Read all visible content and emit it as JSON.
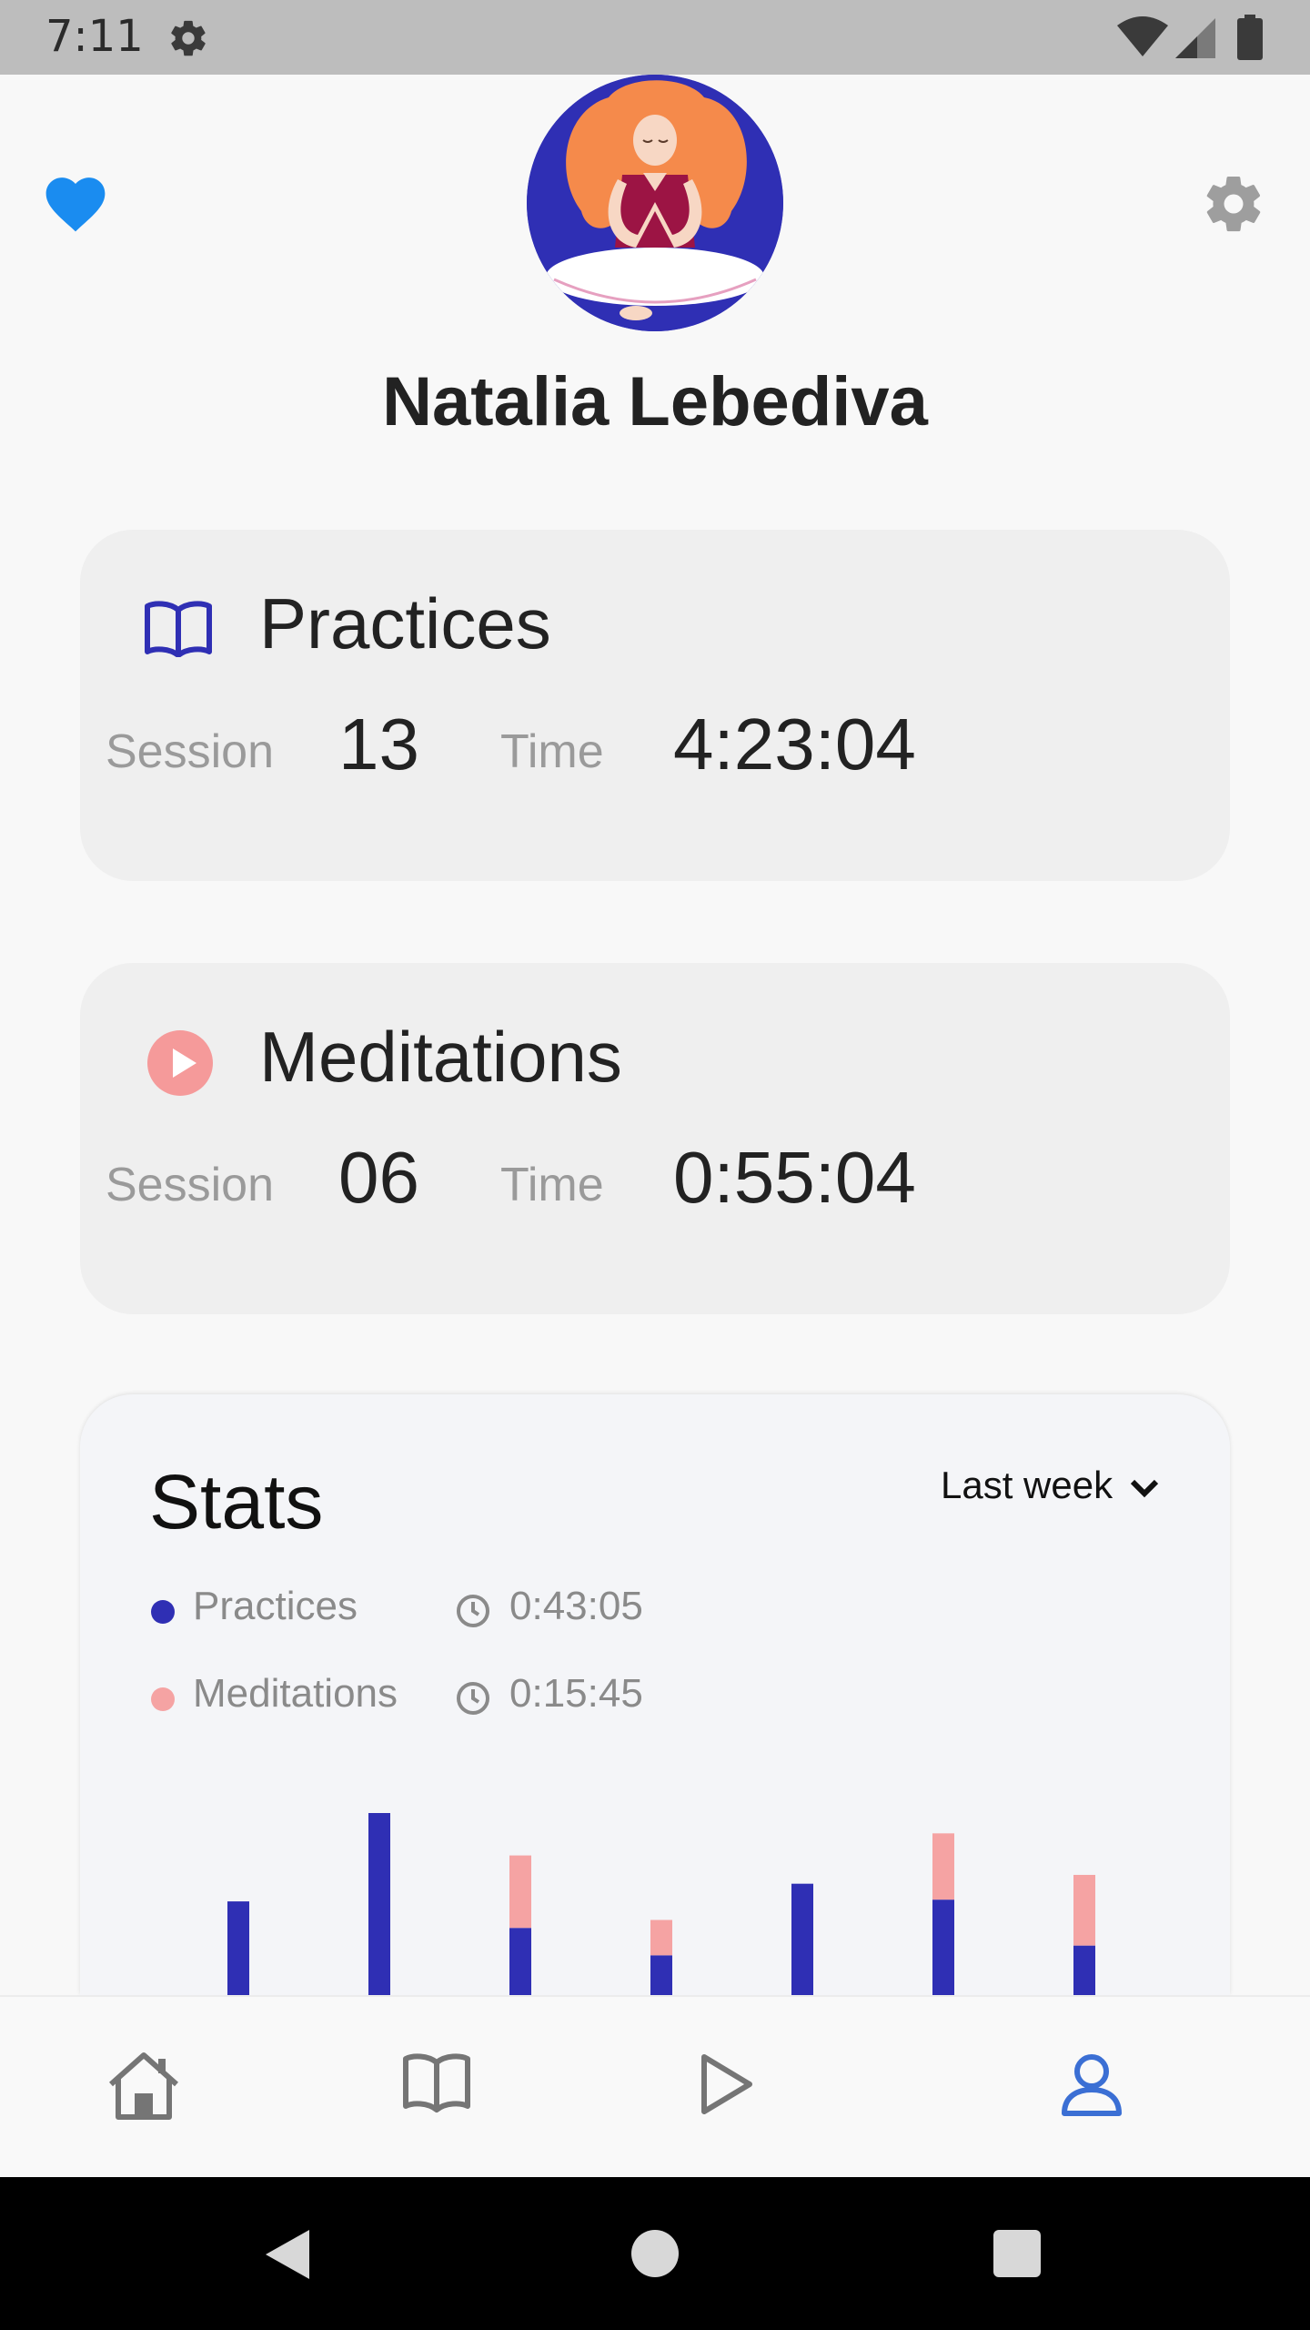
{
  "status_bar": {
    "time": "7:11",
    "icons": [
      "gear-icon",
      "wifi-icon",
      "signal-icon",
      "battery-icon"
    ]
  },
  "header": {
    "favorite_icon": "heart-icon",
    "settings_icon": "gear-icon",
    "avatar_icon": "meditating-woman-illustration",
    "name": "Natalia Lebediva"
  },
  "cards": {
    "practices": {
      "icon": "book-open-icon",
      "title": "Practices",
      "session_label": "Session",
      "session_value": "13",
      "time_label": "Time",
      "time_value": "4:23:04"
    },
    "meditations": {
      "icon": "play-circle-icon",
      "title": "Meditations",
      "session_label": "Session",
      "session_value": "06",
      "time_label": "Time",
      "time_value": "0:55:04"
    }
  },
  "stats": {
    "title": "Stats",
    "range_label": "Last week",
    "legend": [
      {
        "name": "Practices",
        "time": "0:43:05",
        "color": "#2f2fb4"
      },
      {
        "name": "Meditations",
        "time": "0:15:45",
        "color": "#f5a3a3"
      }
    ]
  },
  "chart_data": {
    "type": "bar",
    "categories": [
      "",
      "",
      "",
      "",
      "",
      "",
      ""
    ],
    "series": [
      {
        "name": "Practices",
        "values": [
          1.06,
          2.06,
          0.76,
          0.45,
          1.26,
          1.08,
          0.56
        ]
      },
      {
        "name": "Meditations",
        "values": [
          0,
          0,
          0.82,
          0.4,
          0,
          0.75,
          0.8
        ]
      }
    ],
    "stacked": true,
    "colors": [
      "#2f2fb4",
      "#f5a3a3"
    ],
    "ylim": [
      0,
      2.2
    ]
  },
  "bottom_nav": {
    "items": [
      "home-icon",
      "book-open-icon",
      "play-icon",
      "user-icon"
    ],
    "active_index": 3
  },
  "system_nav": [
    "back-icon",
    "home-circle-icon",
    "recents-icon"
  ]
}
